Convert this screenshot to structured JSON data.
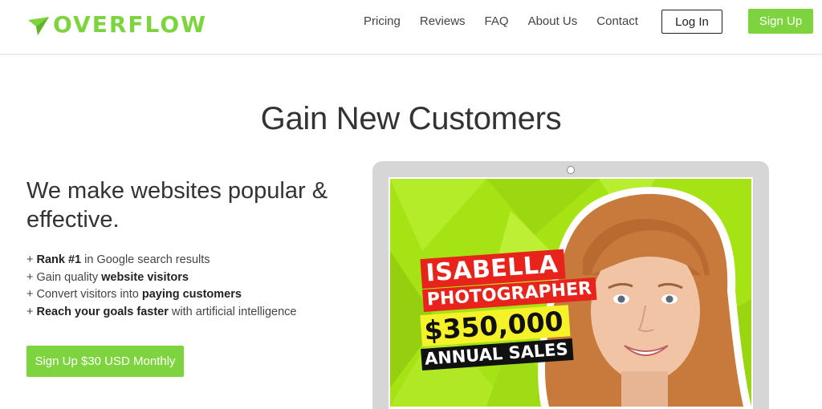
{
  "brand": {
    "name": "OVERFLOW",
    "color": "#7ed43f",
    "logo_icon": "paper-plane-icon"
  },
  "nav": {
    "links": [
      "Pricing",
      "Reviews",
      "FAQ",
      "About Us",
      "Contact"
    ],
    "login_label": "Log In",
    "signup_label": "Sign Up"
  },
  "hero": {
    "title": "Gain New Customers",
    "tagline": "We make websites popular & effective.",
    "features": [
      {
        "prefix": "+ ",
        "bold1": "Rank #1",
        "mid": " in Google search results",
        "bold2": "",
        "suffix": ""
      },
      {
        "prefix": "+ Gain quality ",
        "bold1": "website visitors",
        "mid": "",
        "bold2": "",
        "suffix": ""
      },
      {
        "prefix": "+ Convert visitors into ",
        "bold1": "paying customers",
        "mid": "",
        "bold2": "",
        "suffix": ""
      },
      {
        "prefix": "+ ",
        "bold1": "Reach your goals faster",
        "mid": " with artificial intelligence",
        "bold2": "",
        "suffix": ""
      }
    ],
    "cta_label": "Sign Up $30 USD Monthly"
  },
  "showcase": {
    "name": "ISABELLA",
    "role": "PHOTOGRAPHER",
    "amount": "$350,000",
    "subtitle": "ANNUAL SALES",
    "colors": {
      "background": "#a6e314",
      "name_banner": "#e8231c",
      "amount_banner": "#f6f22a",
      "subtitle_banner": "#111111",
      "hair": "#c77a3c",
      "skin": "#f0c4a4"
    }
  }
}
